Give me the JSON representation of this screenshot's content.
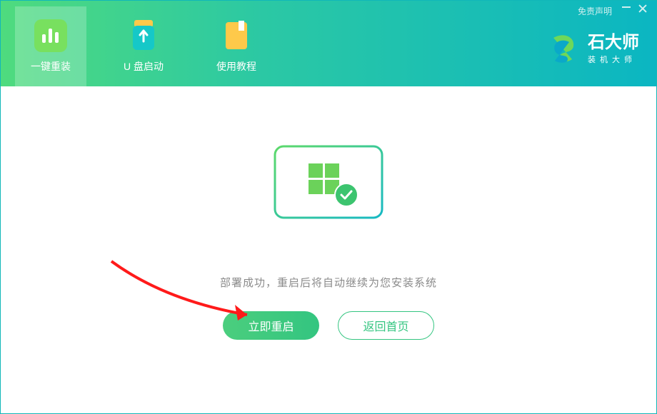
{
  "header": {
    "disclaimer": "免责声明",
    "nav": [
      {
        "label": "一键重装"
      },
      {
        "label": "U 盘启动"
      },
      {
        "label": "使用教程"
      }
    ],
    "brand_title": "石大师",
    "brand_sub": "装机大师"
  },
  "main": {
    "success_text": "部署成功，重启后将自动继续为您安装系统",
    "restart_label": "立即重启",
    "home_label": "返回首页"
  },
  "colors": {
    "primary_green": "#34c580",
    "accent_start": "#4fdb7e",
    "accent_end": "#0bb6c2"
  }
}
